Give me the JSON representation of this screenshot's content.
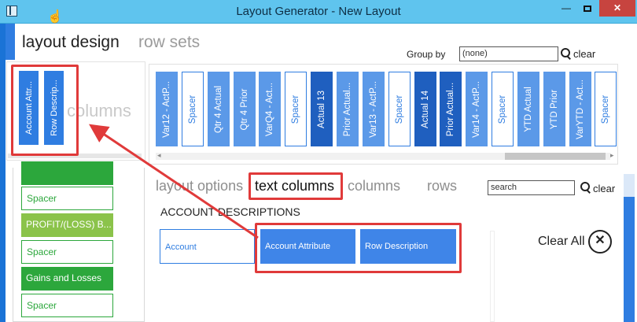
{
  "window": {
    "title": "Layout Generator - New Layout",
    "minimize_glyph": "—",
    "close_glyph": "✕"
  },
  "main_tabs": [
    {
      "label": "layout design",
      "active": true
    },
    {
      "label": "row sets",
      "active": false
    }
  ],
  "group_by": {
    "label": "Group by",
    "value": "(none)",
    "clear_label": "clear"
  },
  "text_columns_panel": {
    "ghost_label": "columns",
    "selected_tiles": [
      "Account Attr...",
      "Row Descrip..."
    ]
  },
  "column_strip": {
    "tiles": [
      {
        "label": "Var12 - ActP...",
        "style": "light"
      },
      {
        "label": "Spacer",
        "style": "spacer"
      },
      {
        "label": "Qtr 4 Actual",
        "style": "light"
      },
      {
        "label": "Qtr 4 Prior",
        "style": "light"
      },
      {
        "label": "VarQ4 - Act...",
        "style": "light"
      },
      {
        "label": "Spacer",
        "style": "spacer"
      },
      {
        "label": "Actual 13",
        "style": "dark"
      },
      {
        "label": "Prior Actual...",
        "style": "light"
      },
      {
        "label": "Var13 - ActP...",
        "style": "light"
      },
      {
        "label": "Spacer",
        "style": "spacer"
      },
      {
        "label": "Actual 14",
        "style": "dark"
      },
      {
        "label": "Prior Actual...",
        "style": "dark"
      },
      {
        "label": "Var14 - ActP...",
        "style": "light"
      },
      {
        "label": "Spacer",
        "style": "spacer"
      },
      {
        "label": "YTD Actual",
        "style": "light"
      },
      {
        "label": "YTD Prior",
        "style": "light"
      },
      {
        "label": "VarYTD - Act...",
        "style": "light"
      },
      {
        "label": "Spacer",
        "style": "spacer"
      }
    ]
  },
  "rows_list": {
    "items": [
      {
        "label": "",
        "style": "green"
      },
      {
        "label": "Spacer",
        "style": "spacer"
      },
      {
        "label": "PROFIT/(LOSS) B...",
        "style": "olive"
      },
      {
        "label": "Spacer",
        "style": "spacer"
      },
      {
        "label": "Gains and Losses",
        "style": "green"
      },
      {
        "label": "Spacer",
        "style": "spacer"
      }
    ]
  },
  "sub_tabs": [
    {
      "label": "layout options",
      "active": false
    },
    {
      "label": "text columns",
      "active": true
    },
    {
      "label": "columns",
      "active": false
    },
    {
      "label": "rows",
      "active": false
    }
  ],
  "search": {
    "value": "search",
    "clear_label": "clear"
  },
  "account_descriptions": {
    "title": "ACCOUNT DESCRIPTIONS",
    "buttons": [
      {
        "label": "Account",
        "style": "outline"
      },
      {
        "label": "Account Attribute",
        "style": "filled"
      },
      {
        "label": "Row Description",
        "style": "filled"
      }
    ]
  },
  "clear_all": {
    "label": "Clear All",
    "icon_glyph": "✕"
  },
  "colors": {
    "titlebar": "#5fc4ee",
    "accent_blue": "#2f7de1",
    "dark_blue": "#1f5fbf",
    "green": "#2ca73c",
    "olive": "#8bc34a",
    "annotation_red": "#e03a3a",
    "close_red": "#c7443f"
  },
  "icons": [
    "app-icon",
    "cursor-icon",
    "minimize-icon",
    "maximize-icon",
    "close-icon",
    "search-icon",
    "clear-all-icon"
  ]
}
